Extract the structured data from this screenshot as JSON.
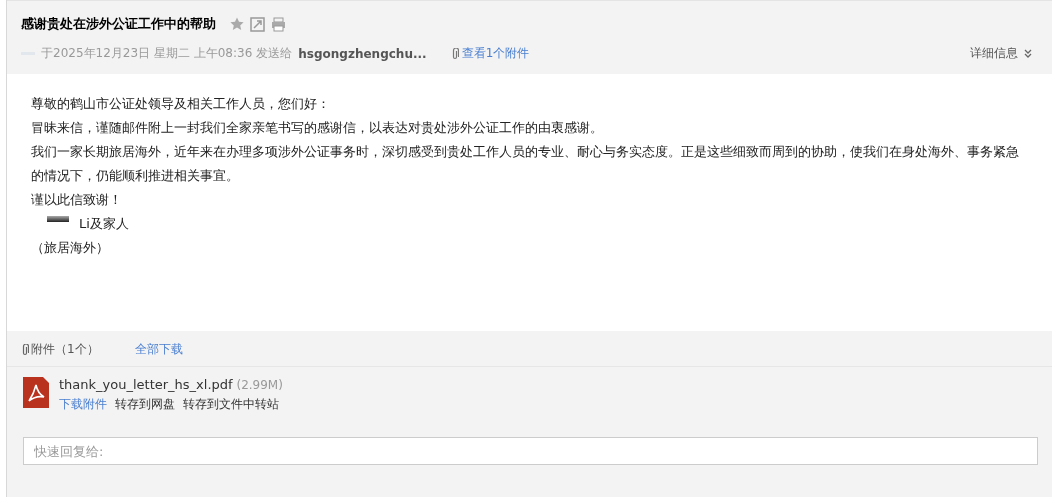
{
  "subject": "感谢贵处在涉外公证工作中的帮助",
  "meta": {
    "date": "于2025年12月23日 星期二 上午08:36",
    "send_to_label": "发送给",
    "recipient": "hsgongzhengchu...",
    "attachments_link": "查看1个附件",
    "details": "详细信息"
  },
  "body": {
    "paragraphs": [
      "尊敬的鹤山市公证处领导及相关工作人员，您们好：",
      "冒昧来信，谨随邮件附上一封我们全家亲笔书写的感谢信，以表达对贵处涉外公证工作的由衷感谢。",
      "我们一家长期旅居海外，近年来在办理多项涉外公证事务时，深切感受到贵处工作人员的专业、耐心与务实态度。正是这些细致而周到的协助，使我们在身处海外、事务紧急的情况下，仍能顺利推进相关事宜。",
      "谨以此信致谢！"
    ],
    "signature": "Li及家人",
    "note": "（旅居海外）"
  },
  "attachments": {
    "title": "附件（1个）",
    "download_all": "全部下载",
    "files": [
      {
        "name": "thank_you_letter_hs_xl.pdf",
        "size": "(2.99M)",
        "actions": [
          "下载附件",
          "转存到网盘",
          "转存到文件中转站"
        ]
      }
    ]
  },
  "reply": {
    "placeholder": "快速回复给:"
  }
}
